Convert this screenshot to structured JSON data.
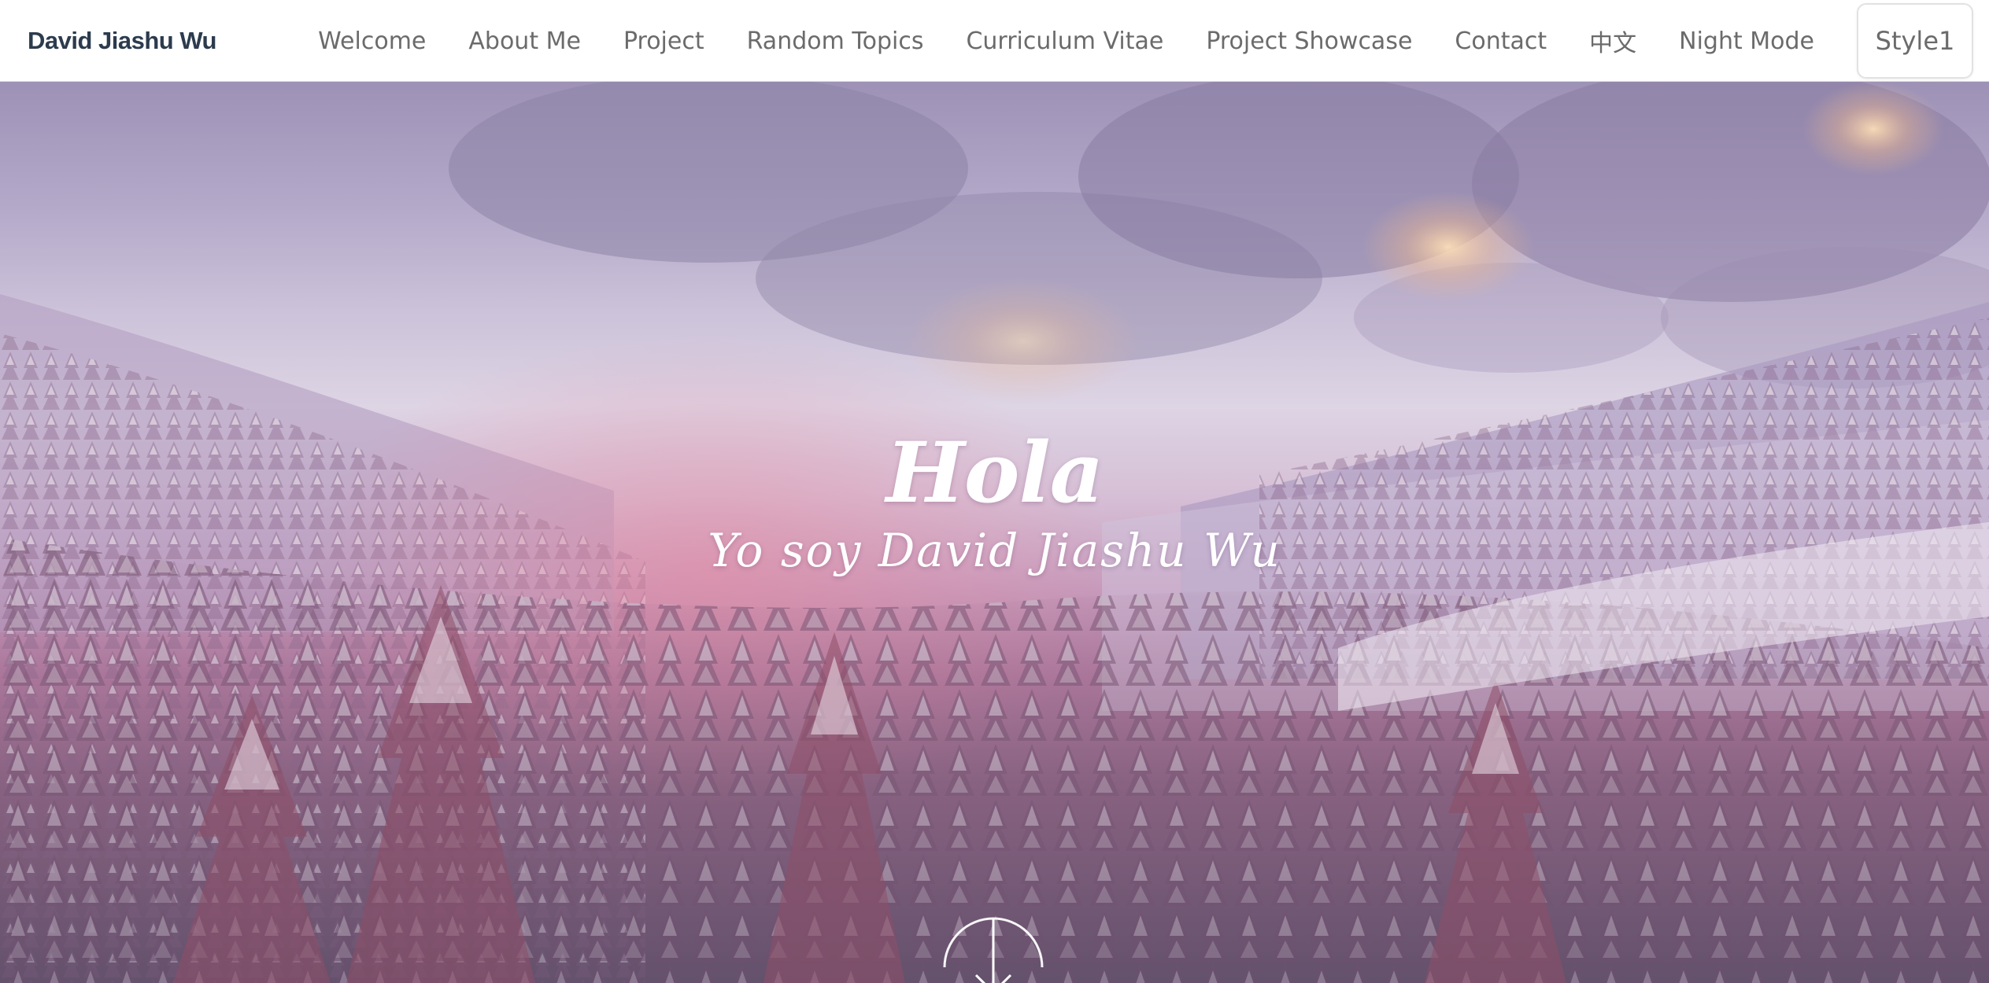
{
  "nav": {
    "brand": "David Jiashu Wu",
    "links": [
      "Welcome",
      "About Me",
      "Project",
      "Random Topics",
      "Curriculum Vitae",
      "Project Showcase",
      "Contact",
      "中文",
      "Night Mode"
    ],
    "style_button": "Style1"
  },
  "hero": {
    "title": "Hola",
    "subtitle": "Yo soy David Jiashu Wu",
    "scroll_icon": "chevron-down-circle-icon"
  },
  "colors": {
    "brand_text": "#2c3b4d",
    "nav_text": "#6b6b6b",
    "hero_text": "#ffffff"
  }
}
